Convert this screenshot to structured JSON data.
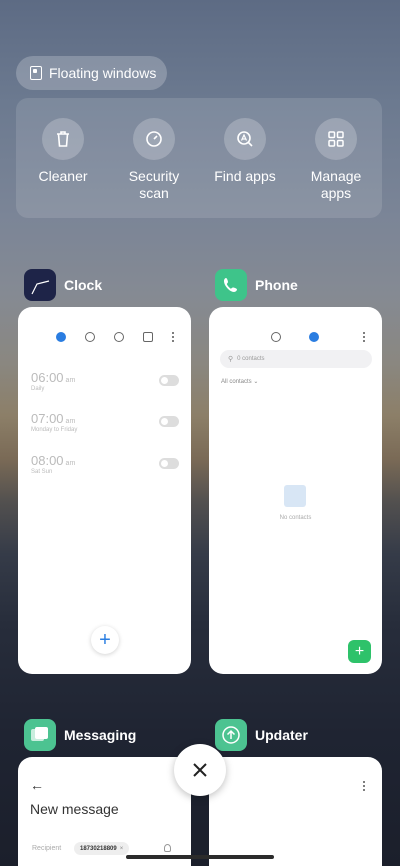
{
  "floating_windows": {
    "label": "Floating windows"
  },
  "tools": [
    {
      "label": "Cleaner",
      "icon": "trash-icon"
    },
    {
      "label": "Security scan",
      "icon": "security-icon"
    },
    {
      "label": "Find apps",
      "icon": "find-apps-icon"
    },
    {
      "label": "Manage apps",
      "icon": "grid-icon"
    }
  ],
  "tools_lines": {
    "security_line1": "Security",
    "security_line2": "scan",
    "manage_line1": "Manage",
    "manage_line2": "apps"
  },
  "cards": {
    "clock": {
      "title": "Clock",
      "alarms": [
        {
          "time": "06:00",
          "ampm": "am",
          "repeat": "Daily"
        },
        {
          "time": "07:00",
          "ampm": "am",
          "repeat": "Monday to Friday"
        },
        {
          "time": "08:00",
          "ampm": "am",
          "repeat": "Sat Sun"
        }
      ],
      "fab": "+"
    },
    "phone": {
      "title": "Phone",
      "search_placeholder": "0 contacts",
      "all_contacts": "All contacts",
      "empty_text": "No contacts",
      "fab": "+"
    },
    "messaging": {
      "title": "Messaging",
      "header": "New message",
      "recipient_label": "Recipient",
      "recipient_chip": "18730218809"
    },
    "updater": {
      "title": "Updater"
    }
  },
  "colors": {
    "clock_icon_bg": "#1e2448",
    "phone_icon_bg": "#3ec48a",
    "messaging_icon_bg": "#4cc391",
    "updater_icon_bg": "#4cc391",
    "clock_accent": "#2a7de1",
    "phone_fab": "#2ec26a"
  }
}
